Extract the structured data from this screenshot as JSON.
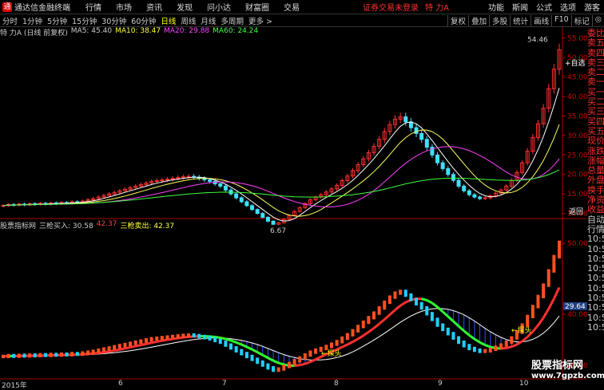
{
  "menubar": {
    "app_title": "通达信金融终端",
    "items": [
      "行情",
      "市场",
      "资讯",
      "发现",
      "问小达",
      "财富圈",
      "交易"
    ],
    "warning": "证券交易未登录",
    "stock": "特 力A",
    "right_items": [
      "功能",
      "斯闻",
      "公式",
      "选项"
    ],
    "user": "游客"
  },
  "toolbar": {
    "periods": [
      "分时",
      "1分钟",
      "5分钟",
      "15分钟",
      "30分钟",
      "60分钟",
      "日线",
      "周线",
      "月线",
      "多周期",
      "更多 >"
    ],
    "active": "日线",
    "right_items": [
      "复权",
      "叠加",
      "多股",
      "统计",
      "画线",
      "F10",
      "标记",
      "◎"
    ]
  },
  "main_info": {
    "title": "特 力A (日线 前复权)",
    "ma5": "MA5: 45.40",
    "ma10": "MA10: 38.47",
    "ma20": "MA20: 29.88",
    "ma60": "MA60: 24.24",
    "high_label": "54.46",
    "low_label": "6.67",
    "button_auto": "+自选",
    "button_back": "返回"
  },
  "indicator_info": {
    "title": "股票指标网",
    "buy_label": "三枪买入: 30.58",
    "mid_value": "42.37",
    "sell_label": "三枪卖出: 42.37",
    "current_price": "29.64",
    "note1": "探头",
    "note2": "探头"
  },
  "axes": {
    "main_ticks": [
      "55.00",
      "50.00",
      "45.00",
      "40.00",
      "35.00",
      "30.00",
      "25.00",
      "20.00",
      "15.00",
      "10.00"
    ],
    "ind_ticks": [
      "50.00",
      "40.00",
      "20.00"
    ],
    "x_labels": [
      "2015年",
      "6",
      "7",
      "8",
      "9",
      "10"
    ]
  },
  "sidepanel": {
    "items": [
      "委比",
      "卖五",
      "卖四",
      "卖三",
      "卖二",
      "卖一",
      "买一",
      "买二",
      "买三",
      "买四",
      "买五",
      "现价",
      "涨跌",
      "涨幅",
      "总量",
      "外盘",
      "换手",
      "净资",
      "收益",
      "自动",
      "行情",
      "10:5",
      "10:5",
      "10:5",
      "10:5",
      "10:5",
      "10:5",
      "10:5",
      "10:5",
      "10:5",
      "10:5"
    ]
  },
  "watermark": {
    "line1": "股票指标网",
    "line2": "www.7gpzb.com"
  },
  "chart_data": {
    "type": "candlestick",
    "ylim": [
      5,
      57
    ],
    "closes": [
      12.0,
      12.3,
      12.1,
      12.4,
      12.2,
      12.5,
      12.3,
      12.6,
      12.4,
      12.7,
      12.5,
      12.8,
      12.6,
      13.0,
      12.8,
      13.2,
      13.5,
      13.8,
      14.2,
      14.6,
      15.0,
      15.4,
      15.8,
      16.2,
      16.6,
      17.0,
      17.4,
      17.8,
      18.2,
      18.4,
      18.6,
      18.8,
      19.0,
      19.2,
      19.4,
      19.5,
      19.3,
      19.0,
      18.6,
      18.2,
      17.6,
      17.0,
      16.0,
      15.0,
      14.0,
      13.0,
      12.0,
      11.0,
      10.0,
      9.0,
      8.0,
      7.2,
      7.6,
      8.5,
      9.5,
      10.5,
      11.5,
      12.5,
      13.5,
      14.2,
      14.8,
      15.5,
      16.3,
      17.2,
      18.4,
      19.6,
      21.0,
      22.5,
      24.0,
      25.6,
      27.2,
      29.0,
      31.0,
      32.8,
      34.2,
      34.8,
      33.5,
      32.0,
      30.5,
      29.0,
      27.0,
      25.0,
      23.0,
      21.5,
      20.0,
      18.5,
      17.0,
      15.8,
      14.8,
      14.2,
      13.8,
      14.0,
      14.5,
      15.2,
      16.0,
      17.0,
      18.5,
      20.5,
      23.0,
      26.0,
      29.5,
      33.0,
      37.0,
      42.0,
      47.0,
      52.0
    ]
  }
}
